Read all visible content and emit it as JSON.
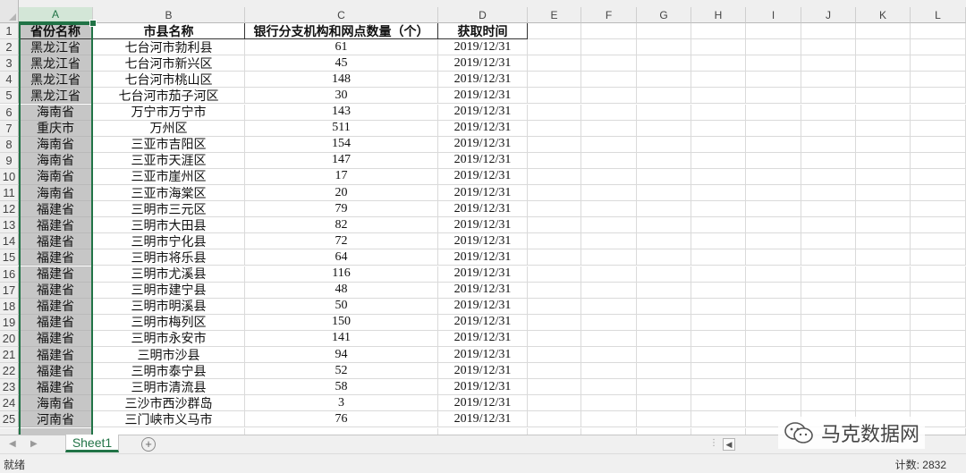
{
  "columns": [
    "A",
    "B",
    "C",
    "D",
    "E",
    "F",
    "G",
    "H",
    "I",
    "J",
    "K",
    "L"
  ],
  "header_row": {
    "row": "1",
    "cells": [
      "省份名称",
      "市县名称",
      "银行分支机构和网点数量（个）",
      "获取时间"
    ]
  },
  "rows": [
    {
      "row": "2",
      "cells": [
        "黑龙江省",
        "七台河市勃利县",
        "61",
        "2019/12/31"
      ]
    },
    {
      "row": "3",
      "cells": [
        "黑龙江省",
        "七台河市新兴区",
        "45",
        "2019/12/31"
      ]
    },
    {
      "row": "4",
      "cells": [
        "黑龙江省",
        "七台河市桃山区",
        "148",
        "2019/12/31"
      ]
    },
    {
      "row": "5",
      "cells": [
        "黑龙江省",
        "七台河市茄子河区",
        "30",
        "2019/12/31"
      ]
    },
    {
      "row": "6",
      "cells": [
        "海南省",
        "万宁市万宁市",
        "143",
        "2019/12/31"
      ]
    },
    {
      "row": "7",
      "cells": [
        "重庆市",
        "万州区",
        "511",
        "2019/12/31"
      ]
    },
    {
      "row": "8",
      "cells": [
        "海南省",
        "三亚市吉阳区",
        "154",
        "2019/12/31"
      ]
    },
    {
      "row": "9",
      "cells": [
        "海南省",
        "三亚市天涯区",
        "147",
        "2019/12/31"
      ]
    },
    {
      "row": "10",
      "cells": [
        "海南省",
        "三亚市崖州区",
        "17",
        "2019/12/31"
      ]
    },
    {
      "row": "11",
      "cells": [
        "海南省",
        "三亚市海棠区",
        "20",
        "2019/12/31"
      ]
    },
    {
      "row": "12",
      "cells": [
        "福建省",
        "三明市三元区",
        "79",
        "2019/12/31"
      ]
    },
    {
      "row": "13",
      "cells": [
        "福建省",
        "三明市大田县",
        "82",
        "2019/12/31"
      ]
    },
    {
      "row": "14",
      "cells": [
        "福建省",
        "三明市宁化县",
        "72",
        "2019/12/31"
      ]
    },
    {
      "row": "15",
      "cells": [
        "福建省",
        "三明市将乐县",
        "64",
        "2019/12/31"
      ]
    },
    {
      "row": "16",
      "cells": [
        "福建省",
        "三明市尤溪县",
        "116",
        "2019/12/31"
      ]
    },
    {
      "row": "17",
      "cells": [
        "福建省",
        "三明市建宁县",
        "48",
        "2019/12/31"
      ]
    },
    {
      "row": "18",
      "cells": [
        "福建省",
        "三明市明溪县",
        "50",
        "2019/12/31"
      ]
    },
    {
      "row": "19",
      "cells": [
        "福建省",
        "三明市梅列区",
        "150",
        "2019/12/31"
      ]
    },
    {
      "row": "20",
      "cells": [
        "福建省",
        "三明市永安市",
        "141",
        "2019/12/31"
      ]
    },
    {
      "row": "21",
      "cells": [
        "福建省",
        "三明市沙县",
        "94",
        "2019/12/31"
      ]
    },
    {
      "row": "22",
      "cells": [
        "福建省",
        "三明市泰宁县",
        "52",
        "2019/12/31"
      ]
    },
    {
      "row": "23",
      "cells": [
        "福建省",
        "三明市清流县",
        "58",
        "2019/12/31"
      ]
    },
    {
      "row": "24",
      "cells": [
        "海南省",
        "三沙市西沙群岛",
        "3",
        "2019/12/31"
      ]
    },
    {
      "row": "25",
      "cells": [
        "河南省",
        "三门峡市义马市",
        "76",
        "2019/12/31"
      ]
    }
  ],
  "sheet_tab": "Sheet1",
  "add_sheet_symbol": "+",
  "status": {
    "ready": "就绪",
    "count": "计数: 2832"
  },
  "watermark": {
    "text": "马克数据网",
    "icon": "wechat-icon"
  },
  "colors": {
    "accent": "#217346",
    "selected_column": "#c6c6c6"
  }
}
